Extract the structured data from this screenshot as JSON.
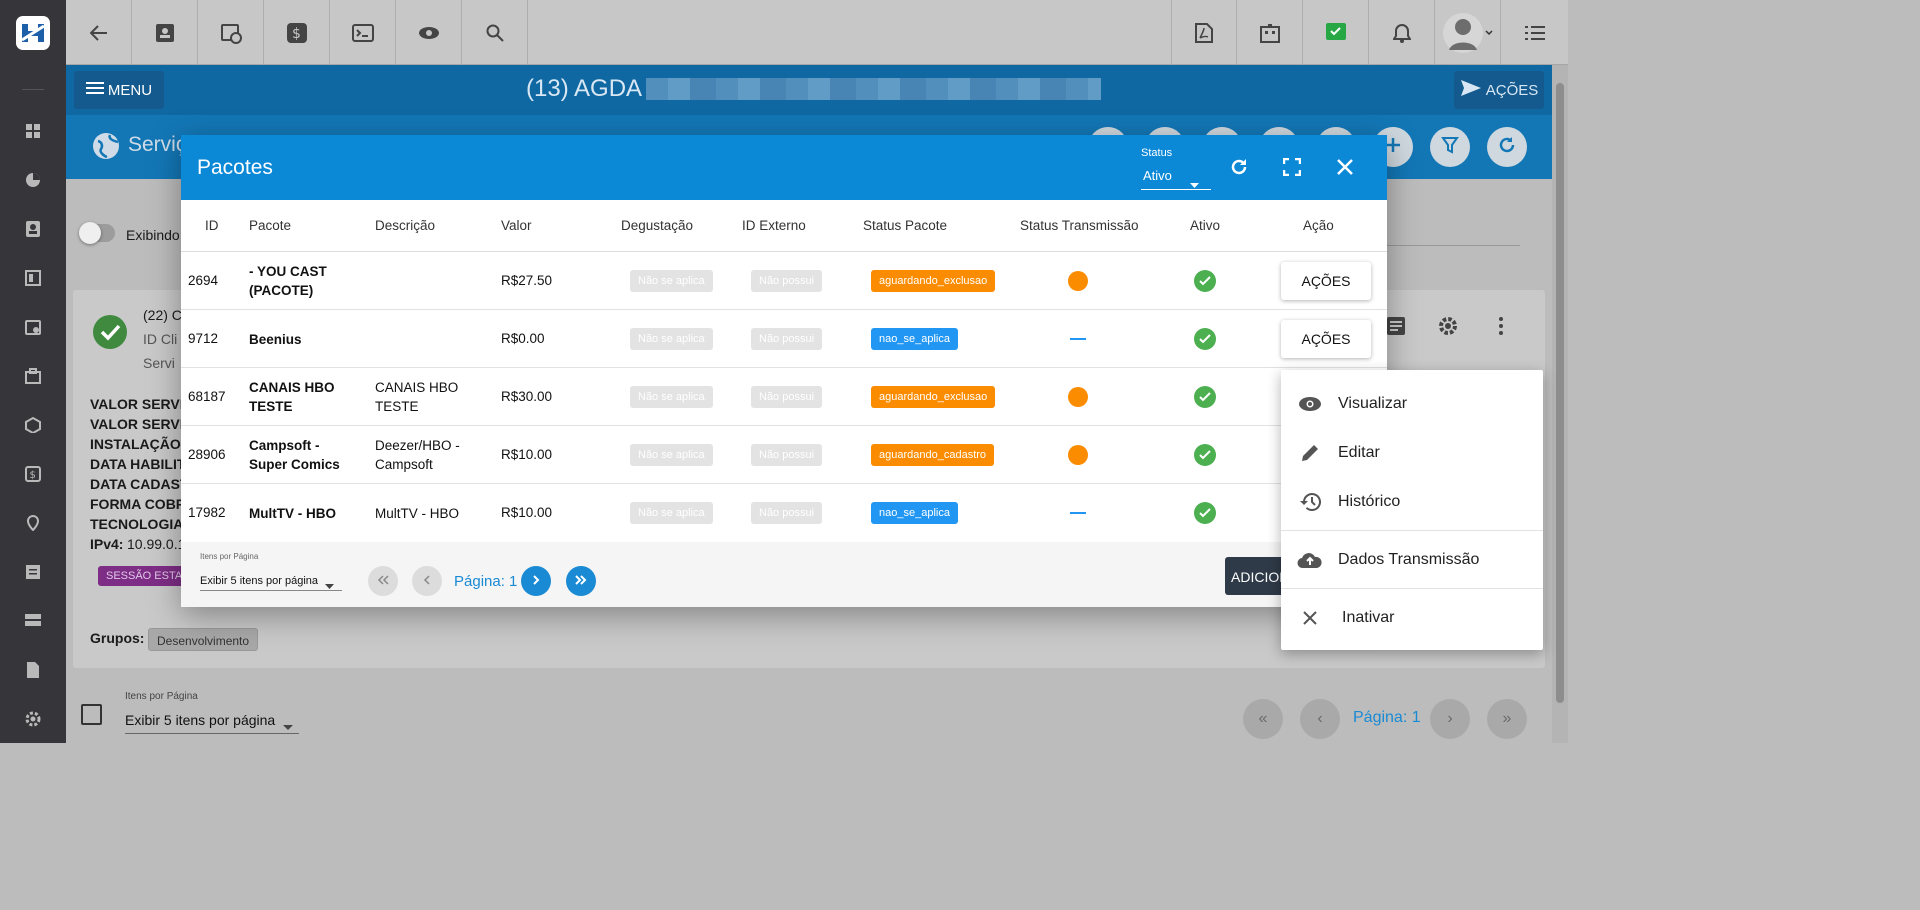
{
  "header": {
    "client_title": "(13) AGDA",
    "menu_label": "MENU",
    "acoes_label": "AÇÕES",
    "section_title": "Serviç"
  },
  "background": {
    "toggle_label": "Exibindo",
    "card_title": "(22) C",
    "card_line2": "ID Cli",
    "card_line3": "Servi",
    "details": [
      "VALOR SERVIÇ",
      "VALOR SERVIÇ",
      "INSTALAÇÃO:",
      "DATA HABILIT",
      "DATA CADAST",
      "FORMA COBRA",
      "TECNOLOGIA"
    ],
    "ipv4_label": "IPv4:",
    "ipv4_value": "10.99.0.1",
    "session_badge": "SESSÃO ESTAC",
    "groups_label": "Grupos:",
    "group_chip": "Desenvolvimento",
    "ipp_label": "Itens por Página",
    "ipp_value": "Exibir 5 itens por página",
    "page_label": "Página: 1"
  },
  "modal": {
    "title": "Pacotes",
    "status_label": "Status",
    "status_value": "Ativo",
    "columns": [
      "ID",
      "Pacote",
      "Descrição",
      "Valor",
      "Degustação",
      "ID Externo",
      "Status Pacote",
      "Status Transmissão",
      "Ativo",
      "Ação"
    ],
    "rows": [
      {
        "id": "2694",
        "pacote": "- YOU CAST (PACOTE)",
        "descricao": "",
        "valor": "R$27.50",
        "degustacao": "Não se aplica",
        "id_externo": "Não possui",
        "status_pacote": "aguardando_exclusao",
        "transmissao": "orange",
        "acao": "AÇÕES"
      },
      {
        "id": "9712",
        "pacote": "Beenius",
        "descricao": "",
        "valor": "R$0.00",
        "degustacao": "Não se aplica",
        "id_externo": "Não possui",
        "status_pacote": "nao_se_aplica",
        "transmissao": "dash",
        "acao": "AÇÕES"
      },
      {
        "id": "68187",
        "pacote": "CANAIS HBO TESTE",
        "descricao": "CANAIS HBO TESTE",
        "valor": "R$30.00",
        "degustacao": "Não se aplica",
        "id_externo": "Não possui",
        "status_pacote": "aguardando_exclusao",
        "transmissao": "orange",
        "acao": ""
      },
      {
        "id": "28906",
        "pacote": "Campsoft - Super Comics",
        "descricao": "Deezer/HBO - Campsoft",
        "valor": "R$10.00",
        "degustacao": "Não se aplica",
        "id_externo": "Não possui",
        "status_pacote": "aguardando_cadastro",
        "transmissao": "orange",
        "acao": ""
      },
      {
        "id": "17982",
        "pacote": "MultTV - HBO",
        "descricao": "MultTV - HBO",
        "valor": "R$10.00",
        "degustacao": "Não se aplica",
        "id_externo": "Não possui",
        "status_pacote": "nao_se_aplica",
        "transmissao": "dash",
        "acao": ""
      }
    ],
    "footer": {
      "ipp_label": "Itens por Página",
      "ipp_value": "Exibir 5 itens por página",
      "page_label": "Página: 1",
      "add_label": "ADICIONAR"
    }
  },
  "dropdown": {
    "items": [
      {
        "label": "Visualizar",
        "icon": "eye-icon"
      },
      {
        "label": "Editar",
        "icon": "pencil-icon"
      },
      {
        "label": "Histórico",
        "icon": "history-icon"
      },
      {
        "label": "Dados Transmissão",
        "icon": "cloud-upload-icon"
      },
      {
        "label": "Inativar",
        "icon": "close-icon"
      }
    ]
  },
  "colors": {
    "primary_blue": "#0b88d6",
    "orange": "#fb8c00",
    "chip_blue": "#2196f3",
    "green": "#4caf50",
    "sidebar": "#35353a"
  }
}
